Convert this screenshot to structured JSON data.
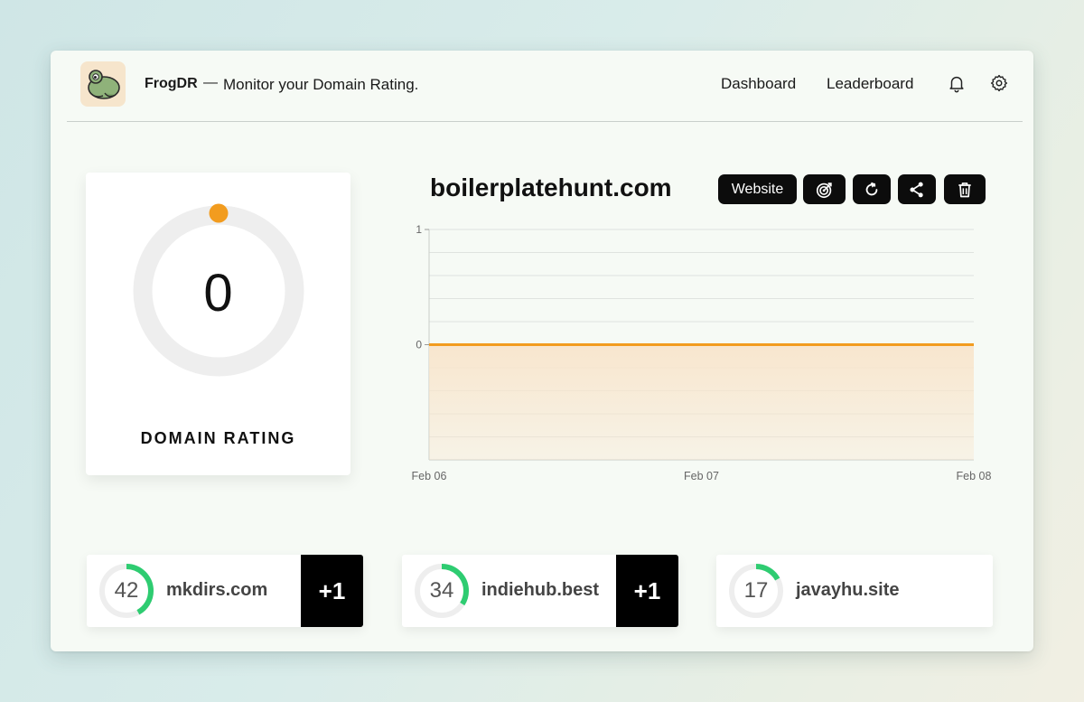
{
  "header": {
    "brand": "FrogDR",
    "dash": "—",
    "tagline": "Monitor your Domain Rating.",
    "nav": [
      "Dashboard",
      "Leaderboard"
    ],
    "icons": [
      "bell-icon",
      "gear-icon"
    ]
  },
  "rating_card": {
    "value": "0",
    "label": "DOMAIN RATING",
    "ring_color": "#f29c1f",
    "track_color": "#eeeeee"
  },
  "site": {
    "domain": "boilerplatehunt.com",
    "buttons": {
      "website": "Website",
      "icons": [
        "target-icon",
        "refresh-icon",
        "share-icon",
        "trash-icon"
      ]
    }
  },
  "chart_data": {
    "type": "area",
    "x": [
      "Feb 06",
      "Feb 07",
      "Feb 08"
    ],
    "series": [
      {
        "values": [
          0,
          0,
          0
        ]
      }
    ],
    "ytick_labels": [
      "1",
      "0"
    ],
    "ylim": [
      -1,
      1
    ],
    "grid": true,
    "line_color": "#f29c1f",
    "fill_color": "#f8e5cc"
  },
  "leaderboard": [
    {
      "rating": "42",
      "domain": "mkdirs.com",
      "delta": "+1",
      "progress": 0.42
    },
    {
      "rating": "34",
      "domain": "indiehub.best",
      "delta": "+1",
      "progress": 0.34
    },
    {
      "rating": "17",
      "domain": "javayhu.site",
      "delta": "",
      "progress": 0.17
    }
  ],
  "accent_green": "#2ecc71"
}
